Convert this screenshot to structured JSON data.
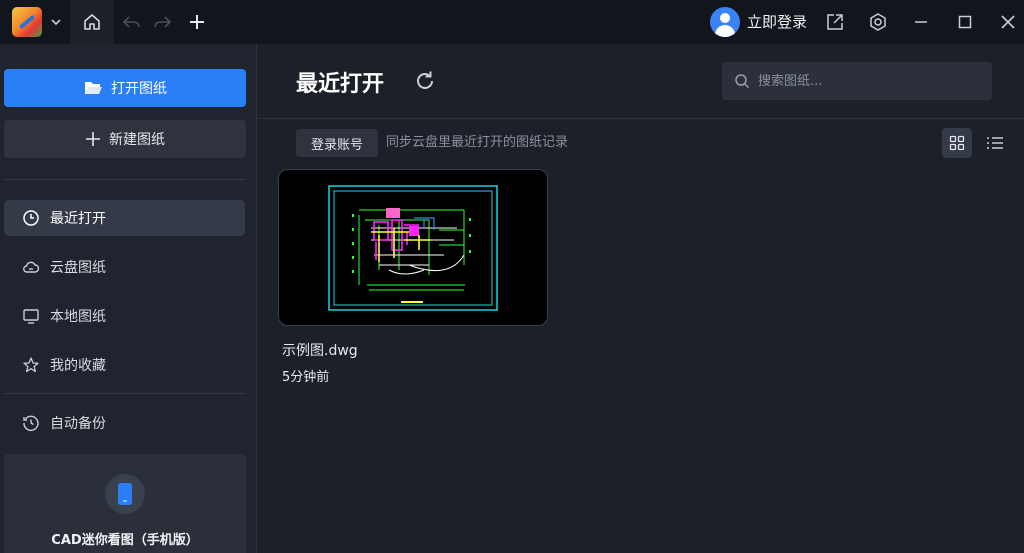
{
  "titlebar": {
    "icons": [
      "logo-icon",
      "chevron-down-icon",
      "home-icon",
      "undo-icon",
      "redo-icon",
      "plus-icon",
      "user-avatar-icon",
      "share-icon",
      "settings-icon",
      "minimize-icon",
      "maximize-icon",
      "close-icon"
    ],
    "login_label": "立即登录"
  },
  "sidebar": {
    "open_label": "打开图纸",
    "new_label": "新建图纸",
    "items": [
      {
        "label": "最近打开",
        "icon": "clock-icon",
        "active": true
      },
      {
        "label": "云盘图纸",
        "icon": "cloud-icon",
        "active": false
      },
      {
        "label": "本地图纸",
        "icon": "monitor-icon",
        "active": false
      },
      {
        "label": "我的收藏",
        "icon": "star-icon",
        "active": false
      }
    ],
    "backup_label": "自动备份",
    "promo_label": "CAD迷你看图（手机版）"
  },
  "main": {
    "title": "最近打开",
    "search_placeholder": "搜索图纸...",
    "account_button": "登录账号",
    "sync_text": "同步云盘里最近打开的图纸记录",
    "files": [
      {
        "name": "示例图.dwg",
        "time": "5分钟前"
      }
    ]
  },
  "colors": {
    "accent": "#2a7ef6",
    "background": "#1c2029",
    "sidebar": "#20242e",
    "titlebar": "#12151c"
  }
}
